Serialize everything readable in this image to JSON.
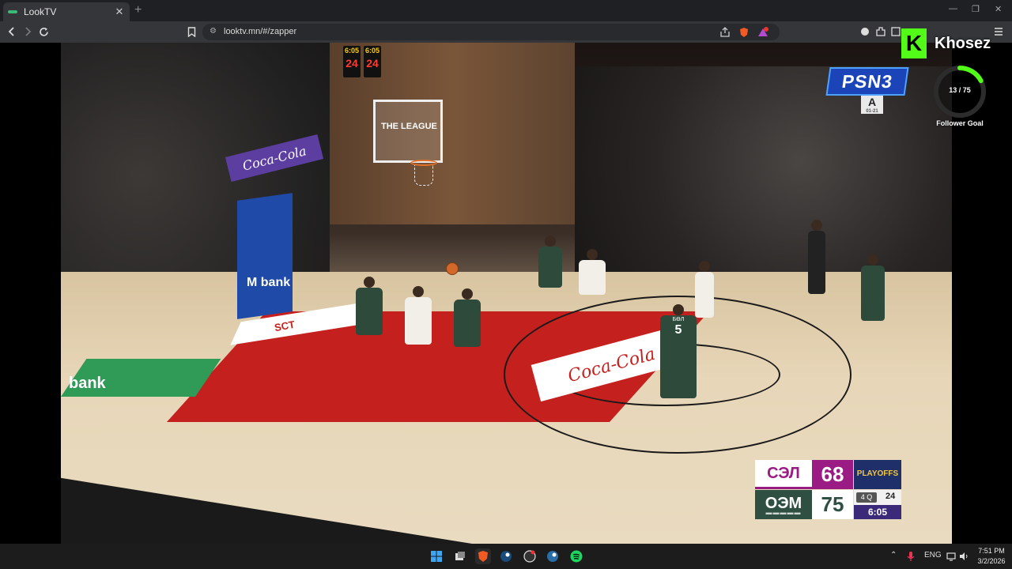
{
  "browser": {
    "tab_title": "LookTV",
    "tab_close": "✕",
    "new_tab": "+",
    "url": "looktv.mn/#/zapper",
    "window_controls": [
      "—",
      "❐",
      "✕"
    ]
  },
  "stream": {
    "channel_logo": "PSN3",
    "arena_sign": "A",
    "arena_sign_sub": "01-21",
    "board_ad": "Coca-Cola",
    "backboard_text": "THE LEAGUE",
    "pillar_ad": "M bank",
    "floor_ad_sct": "SCT",
    "floor_ad_mbank": "bank",
    "floor_ad_coke": "Coca-Cola",
    "shot_clocks": [
      {
        "top": "6:05",
        "main": "24"
      },
      {
        "top": "6:05",
        "main": "24"
      }
    ],
    "players": [
      {
        "num": "5",
        "name": "БӨЛ",
        "team": "green"
      }
    ]
  },
  "overlay": {
    "streamer_badge": "K",
    "streamer_name": "Khosez",
    "follower_progress": "13 / 75",
    "follower_current": 13,
    "follower_target": 75,
    "follower_label": "Follower Goal",
    "accent_color": "#53fc18"
  },
  "scoreboard": {
    "team1": "СЭЛ",
    "score1": "68",
    "team2": "ОЭМ",
    "score2": "75",
    "team2_dashes": "▬▬▬▬▬",
    "event": "PLAYOFFS",
    "quarter": "4 Q",
    "shot_clock": "24",
    "game_clock": "6:05",
    "team1_color": "#9b1b84",
    "team2_color": "#2f4f43"
  },
  "taskbar": {
    "apps": [
      "start-icon",
      "task-view-icon",
      "brave-icon",
      "steam-icon",
      "obs-icon",
      "steam-2-icon",
      "spotify-icon"
    ],
    "language": "ENG",
    "time": "7:51 PM",
    "date": "3/2/2026"
  }
}
